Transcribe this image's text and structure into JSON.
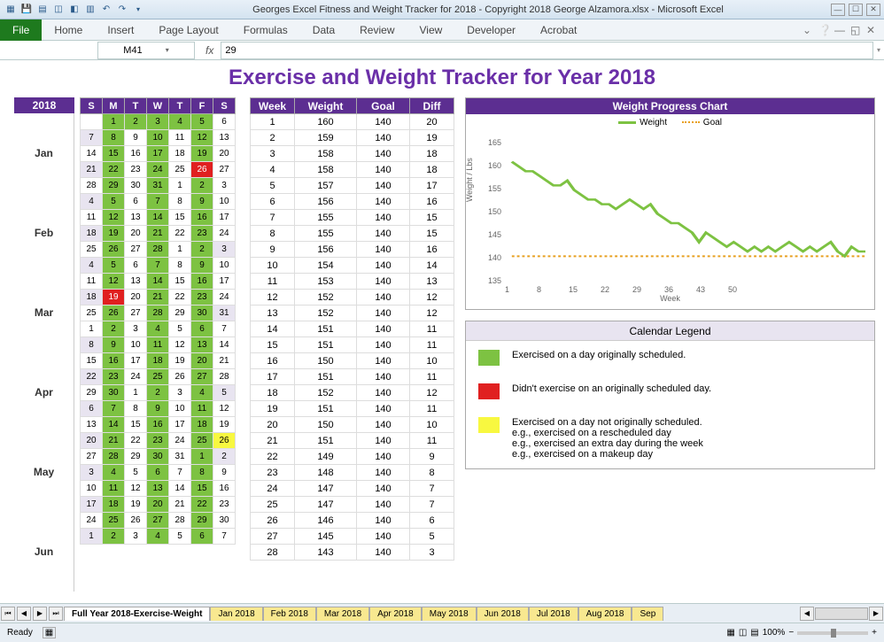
{
  "window": {
    "title": "Georges Excel Fitness and Weight Tracker for 2018 - Copyright 2018 George Alzamora.xlsx  -  Microsoft Excel"
  },
  "ribbon": {
    "file": "File",
    "tabs": [
      "Home",
      "Insert",
      "Page Layout",
      "Formulas",
      "Data",
      "Review",
      "View",
      "Developer",
      "Acrobat"
    ]
  },
  "formula_bar": {
    "name_box": "M41",
    "fx": "fx",
    "value": "29"
  },
  "main_title": "Exercise and Weight Tracker for Year 2018",
  "year": "2018",
  "months": [
    "Jan",
    "Feb",
    "Mar",
    "Apr",
    "May",
    "Jun"
  ],
  "dow": [
    "S",
    "M",
    "T",
    "W",
    "T",
    "F",
    "S"
  ],
  "calendar_rows": [
    {
      "d": [
        "",
        "1",
        "2",
        "3",
        "4",
        "5",
        "6"
      ],
      "c": [
        "",
        "cg",
        "cg",
        "cg",
        "cg",
        "cg",
        ""
      ]
    },
    {
      "d": [
        "7",
        "8",
        "9",
        "10",
        "11",
        "12",
        "13"
      ],
      "c": [
        "cl",
        "cg",
        "",
        "cg",
        "",
        "cg",
        ""
      ]
    },
    {
      "d": [
        "14",
        "15",
        "16",
        "17",
        "18",
        "19",
        "20"
      ],
      "c": [
        "",
        "cg",
        "",
        "cg",
        "",
        "cg",
        ""
      ]
    },
    {
      "d": [
        "21",
        "22",
        "23",
        "24",
        "25",
        "26",
        "27"
      ],
      "c": [
        "cl",
        "cg",
        "",
        "cg",
        "",
        "cr",
        ""
      ]
    },
    {
      "d": [
        "28",
        "29",
        "30",
        "31",
        "1",
        "2",
        "3"
      ],
      "c": [
        "",
        "cg",
        "",
        "cg",
        "",
        "cg",
        ""
      ]
    },
    {
      "d": [
        "4",
        "5",
        "6",
        "7",
        "8",
        "9",
        "10"
      ],
      "c": [
        "cl",
        "cg",
        "",
        "cg",
        "",
        "cg",
        ""
      ]
    },
    {
      "d": [
        "11",
        "12",
        "13",
        "14",
        "15",
        "16",
        "17"
      ],
      "c": [
        "",
        "cg",
        "",
        "cg",
        "",
        "cg",
        ""
      ]
    },
    {
      "d": [
        "18",
        "19",
        "20",
        "21",
        "22",
        "23",
        "24"
      ],
      "c": [
        "cl",
        "cg",
        "",
        "cg",
        "",
        "cg",
        ""
      ]
    },
    {
      "d": [
        "25",
        "26",
        "27",
        "28",
        "1",
        "2",
        "3"
      ],
      "c": [
        "",
        "cg",
        "",
        "cg",
        "",
        "cg",
        "cl"
      ]
    },
    {
      "d": [
        "4",
        "5",
        "6",
        "7",
        "8",
        "9",
        "10"
      ],
      "c": [
        "cl",
        "cg",
        "",
        "cg",
        "",
        "cg",
        ""
      ]
    },
    {
      "d": [
        "11",
        "12",
        "13",
        "14",
        "15",
        "16",
        "17"
      ],
      "c": [
        "",
        "cg",
        "",
        "cg",
        "",
        "cg",
        ""
      ]
    },
    {
      "d": [
        "18",
        "19",
        "20",
        "21",
        "22",
        "23",
        "24"
      ],
      "c": [
        "cl",
        "cr",
        "",
        "cg",
        "",
        "cg",
        ""
      ]
    },
    {
      "d": [
        "25",
        "26",
        "27",
        "28",
        "29",
        "30",
        "31"
      ],
      "c": [
        "",
        "cg",
        "",
        "cg",
        "",
        "cg",
        "cl"
      ]
    },
    {
      "d": [
        "1",
        "2",
        "3",
        "4",
        "5",
        "6",
        "7"
      ],
      "c": [
        "",
        "cg",
        "",
        "cg",
        "",
        "cg",
        ""
      ]
    },
    {
      "d": [
        "8",
        "9",
        "10",
        "11",
        "12",
        "13",
        "14"
      ],
      "c": [
        "cl",
        "cg",
        "",
        "cg",
        "",
        "cg",
        ""
      ]
    },
    {
      "d": [
        "15",
        "16",
        "17",
        "18",
        "19",
        "20",
        "21"
      ],
      "c": [
        "",
        "cg",
        "",
        "cg",
        "",
        "cg",
        ""
      ]
    },
    {
      "d": [
        "22",
        "23",
        "24",
        "25",
        "26",
        "27",
        "28"
      ],
      "c": [
        "cl",
        "cg",
        "",
        "cg",
        "",
        "cg",
        ""
      ]
    },
    {
      "d": [
        "29",
        "30",
        "1",
        "2",
        "3",
        "4",
        "5"
      ],
      "c": [
        "",
        "cg",
        "",
        "cg",
        "",
        "cg",
        "cl"
      ]
    },
    {
      "d": [
        "6",
        "7",
        "8",
        "9",
        "10",
        "11",
        "12"
      ],
      "c": [
        "cl",
        "cg",
        "",
        "cg",
        "",
        "cg",
        ""
      ]
    },
    {
      "d": [
        "13",
        "14",
        "15",
        "16",
        "17",
        "18",
        "19"
      ],
      "c": [
        "",
        "cg",
        "",
        "cg",
        "",
        "cg",
        ""
      ]
    },
    {
      "d": [
        "20",
        "21",
        "22",
        "23",
        "24",
        "25",
        "26"
      ],
      "c": [
        "cl",
        "cg",
        "",
        "cg",
        "",
        "cg",
        "cy"
      ]
    },
    {
      "d": [
        "27",
        "28",
        "29",
        "30",
        "31",
        "1",
        "2"
      ],
      "c": [
        "",
        "cg",
        "",
        "cg",
        "",
        "cg",
        "cl"
      ]
    },
    {
      "d": [
        "3",
        "4",
        "5",
        "6",
        "7",
        "8",
        "9"
      ],
      "c": [
        "cl",
        "cg",
        "",
        "cg",
        "",
        "cg",
        ""
      ]
    },
    {
      "d": [
        "10",
        "11",
        "12",
        "13",
        "14",
        "15",
        "16"
      ],
      "c": [
        "",
        "cg",
        "",
        "cg",
        "",
        "cg",
        ""
      ]
    },
    {
      "d": [
        "17",
        "18",
        "19",
        "20",
        "21",
        "22",
        "23"
      ],
      "c": [
        "cl",
        "cg",
        "",
        "cg",
        "",
        "cg",
        ""
      ]
    },
    {
      "d": [
        "24",
        "25",
        "26",
        "27",
        "28",
        "29",
        "30"
      ],
      "c": [
        "",
        "cg",
        "",
        "cg",
        "",
        "cg",
        ""
      ]
    },
    {
      "d": [
        "1",
        "2",
        "3",
        "4",
        "5",
        "6",
        "7"
      ],
      "c": [
        "cl",
        "cg",
        "",
        "cg",
        "",
        "cg",
        ""
      ]
    }
  ],
  "week_headers": [
    "Week",
    "Weight",
    "Goal",
    "Diff"
  ],
  "week_rows": [
    [
      1,
      160,
      140,
      20
    ],
    [
      2,
      159,
      140,
      19
    ],
    [
      3,
      158,
      140,
      18
    ],
    [
      4,
      158,
      140,
      18
    ],
    [
      5,
      157,
      140,
      17
    ],
    [
      6,
      156,
      140,
      16
    ],
    [
      7,
      155,
      140,
      15
    ],
    [
      8,
      155,
      140,
      15
    ],
    [
      9,
      156,
      140,
      16
    ],
    [
      10,
      154,
      140,
      14
    ],
    [
      11,
      153,
      140,
      13
    ],
    [
      12,
      152,
      140,
      12
    ],
    [
      13,
      152,
      140,
      12
    ],
    [
      14,
      151,
      140,
      11
    ],
    [
      15,
      151,
      140,
      11
    ],
    [
      16,
      150,
      140,
      10
    ],
    [
      17,
      151,
      140,
      11
    ],
    [
      18,
      152,
      140,
      12
    ],
    [
      19,
      151,
      140,
      11
    ],
    [
      20,
      150,
      140,
      10
    ],
    [
      21,
      151,
      140,
      11
    ],
    [
      22,
      149,
      140,
      9
    ],
    [
      23,
      148,
      140,
      8
    ],
    [
      24,
      147,
      140,
      7
    ],
    [
      25,
      147,
      140,
      7
    ],
    [
      26,
      146,
      140,
      6
    ],
    [
      27,
      145,
      140,
      5
    ],
    [
      28,
      143,
      140,
      3
    ]
  ],
  "chart": {
    "title": "Weight Progress Chart",
    "legend_weight": "Weight",
    "legend_goal": "Goal",
    "ylabel": "Weight / Lbs",
    "xlabel": "Week",
    "yticks": [
      "165",
      "160",
      "155",
      "150",
      "145",
      "140",
      "135"
    ],
    "xticks": [
      "1",
      "8",
      "15",
      "22",
      "29",
      "36",
      "43",
      "50"
    ]
  },
  "chart_data": {
    "type": "line",
    "xlabel": "Week",
    "ylabel": "Weight / Lbs",
    "ylim": [
      135,
      165
    ],
    "x": [
      1,
      2,
      3,
      4,
      5,
      6,
      7,
      8,
      9,
      10,
      11,
      12,
      13,
      14,
      15,
      16,
      17,
      18,
      19,
      20,
      21,
      22,
      23,
      24,
      25,
      26,
      27,
      28,
      29,
      30,
      31,
      32,
      33,
      34,
      35,
      36,
      37,
      38,
      39,
      40,
      41,
      42,
      43,
      44,
      45,
      46,
      47,
      48,
      49,
      50,
      51,
      52
    ],
    "series": [
      {
        "name": "Weight",
        "values": [
          160,
          159,
          158,
          158,
          157,
          156,
          155,
          155,
          156,
          154,
          153,
          152,
          152,
          151,
          151,
          150,
          151,
          152,
          151,
          150,
          151,
          149,
          148,
          147,
          147,
          146,
          145,
          143,
          145,
          144,
          143,
          142,
          143,
          142,
          141,
          142,
          141,
          142,
          141,
          142,
          143,
          142,
          141,
          142,
          141,
          142,
          143,
          141,
          140,
          142,
          141,
          141
        ]
      },
      {
        "name": "Goal",
        "values": [
          140,
          140,
          140,
          140,
          140,
          140,
          140,
          140,
          140,
          140,
          140,
          140,
          140,
          140,
          140,
          140,
          140,
          140,
          140,
          140,
          140,
          140,
          140,
          140,
          140,
          140,
          140,
          140,
          140,
          140,
          140,
          140,
          140,
          140,
          140,
          140,
          140,
          140,
          140,
          140,
          140,
          140,
          140,
          140,
          140,
          140,
          140,
          140,
          140,
          140,
          140,
          140
        ]
      }
    ]
  },
  "legend": {
    "title": "Calendar Legend",
    "items": [
      {
        "color": "#7dc242",
        "text": "Exercised on a day originally scheduled."
      },
      {
        "color": "#e02020",
        "text": "Didn't exercise on an originally scheduled day."
      },
      {
        "color": "#f8f840",
        "text": "Exercised on a day not originally scheduled.\ne.g., exercised on a rescheduled day\ne.g., exercised an extra day during the week\ne.g., exercised on a makeup day"
      }
    ]
  },
  "sheet_tabs": [
    "Full Year 2018-Exercise-Weight",
    "Jan 2018",
    "Feb 2018",
    "Mar 2018",
    "Apr 2018",
    "May 2018",
    "Jun 2018",
    "Jul 2018",
    "Aug 2018",
    "Sep"
  ],
  "statusbar": {
    "ready": "Ready",
    "zoom": "100%"
  }
}
